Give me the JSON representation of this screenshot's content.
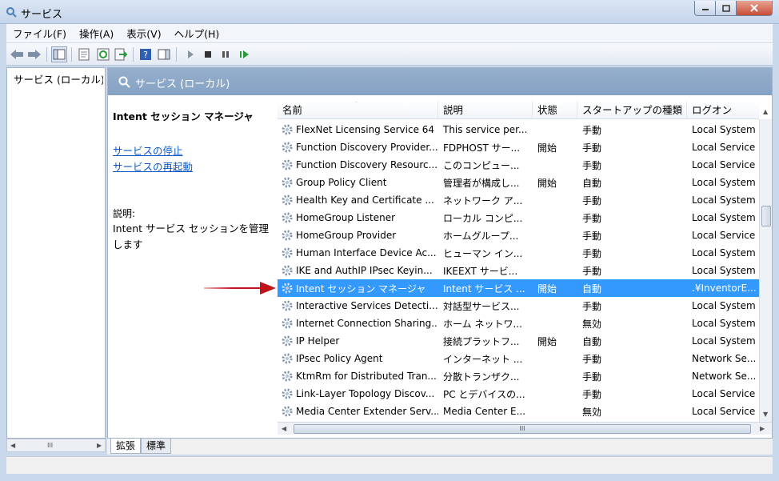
{
  "window": {
    "title": "サービス",
    "min_label": "0",
    "max_label": "1",
    "close_label": "r"
  },
  "menubar": [
    {
      "label": "ファイル(F)"
    },
    {
      "label": "操作(A)"
    },
    {
      "label": "表示(V)"
    },
    {
      "label": "ヘルプ(H)"
    }
  ],
  "toolbar": {
    "icons": [
      "back-icon",
      "forward-icon",
      "console-tree-icon",
      "properties-icon",
      "refresh-icon",
      "export-list-icon",
      "help-icon",
      "action-pane-icon",
      "start-service-icon",
      "stop-service-icon",
      "pause-service-icon",
      "restart-service-icon"
    ]
  },
  "tree": {
    "root_label": "サービス (ローカル)"
  },
  "pane_header": {
    "title": "サービス (ローカル)"
  },
  "detail": {
    "service_name": "Intent セッション マネージャ",
    "stop_link": "サービスの停止",
    "restart_link": "サービスの再起動",
    "desc_label": "説明:",
    "desc_text": "Intent サービス セッションを管理します"
  },
  "list": {
    "sort_indicator": "ˆ",
    "columns": [
      "名前",
      "説明",
      "状態",
      "スタートアップの種類",
      "ログオン"
    ],
    "rows": [
      {
        "name": "FlexNet Licensing Service 64",
        "desc": "This service per...",
        "status": "",
        "startup": "手動",
        "logon": "Local System"
      },
      {
        "name": "Function Discovery Provider...",
        "desc": "FDPHOST サー...",
        "status": "開始",
        "startup": "手動",
        "logon": "Local Service"
      },
      {
        "name": "Function Discovery Resourc...",
        "desc": "このコンピュー...",
        "status": "",
        "startup": "手動",
        "logon": "Local Service"
      },
      {
        "name": "Group Policy Client",
        "desc": "管理者が構成し...",
        "status": "開始",
        "startup": "自動",
        "logon": "Local System"
      },
      {
        "name": "Health Key and Certificate ...",
        "desc": "ネットワーク ア...",
        "status": "",
        "startup": "手動",
        "logon": "Local System"
      },
      {
        "name": "HomeGroup Listener",
        "desc": "ローカル コンピ...",
        "status": "",
        "startup": "手動",
        "logon": "Local System"
      },
      {
        "name": "HomeGroup Provider",
        "desc": "ホームグループ...",
        "status": "",
        "startup": "手動",
        "logon": "Local Service"
      },
      {
        "name": "Human Interface Device Ac...",
        "desc": "ヒューマン イン...",
        "status": "",
        "startup": "手動",
        "logon": "Local System"
      },
      {
        "name": "IKE and AuthIP IPsec Keyin...",
        "desc": "IKEEXT サービ...",
        "status": "",
        "startup": "手動",
        "logon": "Local System"
      },
      {
        "name": "Intent セッション マネージャ",
        "desc": "Intent サービス ...",
        "status": "開始",
        "startup": "自動",
        "logon": ".¥InventorE..."
      },
      {
        "name": "Interactive Services Detecti...",
        "desc": "対話型サービス...",
        "status": "",
        "startup": "手動",
        "logon": "Local System"
      },
      {
        "name": "Internet Connection Sharing...",
        "desc": "ホーム ネットワ...",
        "status": "",
        "startup": "無効",
        "logon": "Local System"
      },
      {
        "name": "IP Helper",
        "desc": "接続プラットフ...",
        "status": "開始",
        "startup": "自動",
        "logon": "Local System"
      },
      {
        "name": "IPsec Policy Agent",
        "desc": "インターネット ...",
        "status": "",
        "startup": "手動",
        "logon": "Network Se..."
      },
      {
        "name": "KtmRm for Distributed Tran...",
        "desc": "分散トランザク...",
        "status": "",
        "startup": "手動",
        "logon": "Network Se..."
      },
      {
        "name": "Link-Layer Topology Discov...",
        "desc": "PC とデバイスの...",
        "status": "",
        "startup": "手動",
        "logon": "Local Service"
      },
      {
        "name": "Media Center Extender Serv...",
        "desc": "Media Center E...",
        "status": "",
        "startup": "無効",
        "logon": "Local Service"
      }
    ],
    "selected_index": 9
  },
  "tabs": [
    {
      "label": "拡張"
    },
    {
      "label": "標準"
    }
  ],
  "scroll": {
    "thumb_label": "III"
  },
  "colors": {
    "selection": "#3399ff",
    "header_band": "#8ea9c8",
    "link": "#0b57c8",
    "arrow": "#c0141b"
  }
}
